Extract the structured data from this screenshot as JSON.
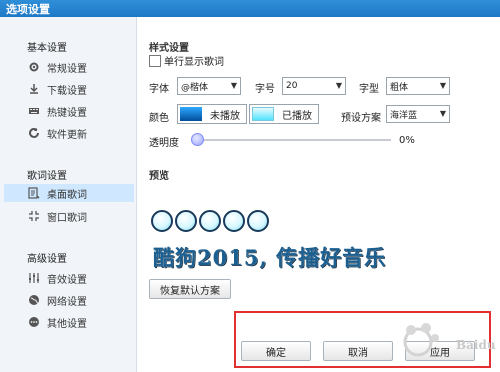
{
  "window": {
    "title": "选项设置"
  },
  "sidebar": {
    "sections": [
      {
        "title": "基本设置",
        "items": [
          {
            "label": "常规设置",
            "icon": "gear-icon"
          },
          {
            "label": "下载设置",
            "icon": "download-icon"
          },
          {
            "label": "热键设置",
            "icon": "keyboard-icon"
          },
          {
            "label": "软件更新",
            "icon": "refresh-icon"
          }
        ]
      },
      {
        "title": "歌词设置",
        "items": [
          {
            "label": "桌面歌词",
            "icon": "desktop-lyrics-icon",
            "active": true
          },
          {
            "label": "窗口歌词",
            "icon": "window-lyrics-icon"
          }
        ]
      },
      {
        "title": "高级设置",
        "items": [
          {
            "label": "音效设置",
            "icon": "equalizer-icon"
          },
          {
            "label": "网络设置",
            "icon": "globe-icon"
          },
          {
            "label": "其他设置",
            "icon": "more-icon"
          }
        ]
      }
    ]
  },
  "style_settings": {
    "heading": "样式设置",
    "single_line_label": "单行显示歌词",
    "font_label": "字体",
    "font_value": "@楷体",
    "size_label": "字号",
    "size_value": "20",
    "weight_label": "字型",
    "weight_value": "粗体",
    "color_label": "颜色",
    "unplayed_label": "未播放",
    "played_label": "已播放",
    "scheme_label": "预设方案",
    "scheme_value": "海洋蓝",
    "opacity_label": "透明度",
    "opacity_value": "0%",
    "opacity_fraction": 0
  },
  "preview": {
    "heading": "预览",
    "lyric": "酷狗2015, 传播好音乐",
    "circle_count": 5,
    "restore_button": "恢复默认方案"
  },
  "footer": {
    "ok_label": "确定",
    "cancel_label": "取消",
    "apply_label": "应用"
  },
  "colors": {
    "titlebar": "#1f78c7",
    "highlight": "#e23030",
    "active_nav": "#cfe8ff"
  }
}
